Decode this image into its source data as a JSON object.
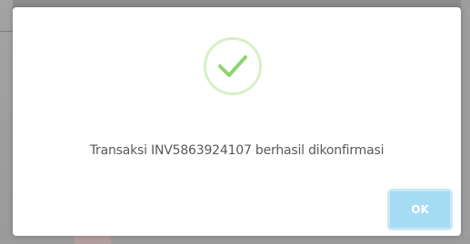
{
  "dialog": {
    "icon": "success-check-icon",
    "message": "Transaksi INV5863924107 berhasil dikonfirmasi",
    "ok_label": "OK"
  },
  "colors": {
    "check_stroke": "#8fd46f",
    "icon_ring": "#d7f0c7",
    "ok_button_bg": "#a6dcf3",
    "message_text": "#595959"
  }
}
